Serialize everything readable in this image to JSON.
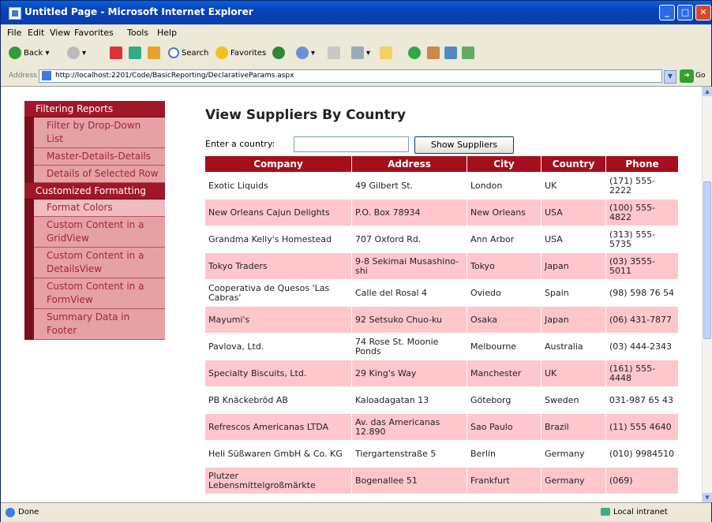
{
  "window": {
    "title": "Untitled Page - Microsoft Internet Explorer",
    "min": "_",
    "max": "□",
    "close": "✕"
  },
  "menubar": [
    "File",
    "Edit",
    "View",
    "Favorites",
    "Tools",
    "Help"
  ],
  "toolbar": {
    "back": "Back",
    "search": "Search",
    "favorites": "Favorites"
  },
  "address": {
    "label": "Address",
    "url": "http://localhost:2201/Code/BasicReporting/DeclarativeParams.aspx",
    "go": "Go"
  },
  "nav": {
    "sections": [
      {
        "header": "Filtering Reports",
        "items": [
          "Filter by Drop-Down List",
          "Master-Details-Details",
          "Details of Selected Row"
        ]
      },
      {
        "header": "Customized Formatting",
        "items": [
          "Format Colors",
          "Custom Content in a GridView",
          "Custom Content in a DetailsView",
          "Custom Content in a FormView",
          "Summary Data in Footer"
        ]
      }
    ]
  },
  "page": {
    "title": "View Suppliers By Country",
    "filter_label": "Enter a country:",
    "country_value": "",
    "button_label": "Show Suppliers"
  },
  "grid": {
    "columns": [
      "Company",
      "Address",
      "City",
      "Country",
      "Phone"
    ],
    "rows": [
      [
        "Exotic Liquids",
        "49 Gilbert St.",
        "London",
        "UK",
        "(171) 555-2222"
      ],
      [
        "New Orleans Cajun Delights",
        "P.O. Box 78934",
        "New Orleans",
        "USA",
        "(100) 555-4822"
      ],
      [
        "Grandma Kelly's Homestead",
        "707 Oxford Rd.",
        "Ann Arbor",
        "USA",
        "(313) 555-5735"
      ],
      [
        "Tokyo Traders",
        "9-8 Sekimai Musashino-shi",
        "Tokyo",
        "Japan",
        "(03) 3555-5011"
      ],
      [
        "Cooperativa de Quesos 'Las Cabras'",
        "Calle del Rosal 4",
        "Oviedo",
        "Spain",
        "(98) 598 76 54"
      ],
      [
        "Mayumi's",
        "92 Setsuko Chuo-ku",
        "Osaka",
        "Japan",
        "(06) 431-7877"
      ],
      [
        "Pavlova, Ltd.",
        "74 Rose St. Moonie Ponds",
        "Melbourne",
        "Australia",
        "(03) 444-2343"
      ],
      [
        "Specialty Biscuits, Ltd.",
        "29 King's Way",
        "Manchester",
        "UK",
        "(161) 555-4448"
      ],
      [
        "PB Knäckebröd AB",
        "Kaloadagatan 13",
        "Göteborg",
        "Sweden",
        "031-987 65 43"
      ],
      [
        "Refrescos Americanas LTDA",
        "Av. das Americanas 12.890",
        "Sao Paulo",
        "Brazil",
        "(11) 555 4640"
      ],
      [
        "Heli Süßwaren GmbH & Co. KG",
        "Tiergartenstraße 5",
        "Berlin",
        "Germany",
        "(010) 9984510"
      ],
      [
        "Plutzer Lebensmittelgroßmärkte",
        "Bogenallee 51",
        "Frankfurt",
        "Germany",
        "(069)"
      ]
    ]
  },
  "status": {
    "text": "Done",
    "zone": "Local intranet"
  }
}
